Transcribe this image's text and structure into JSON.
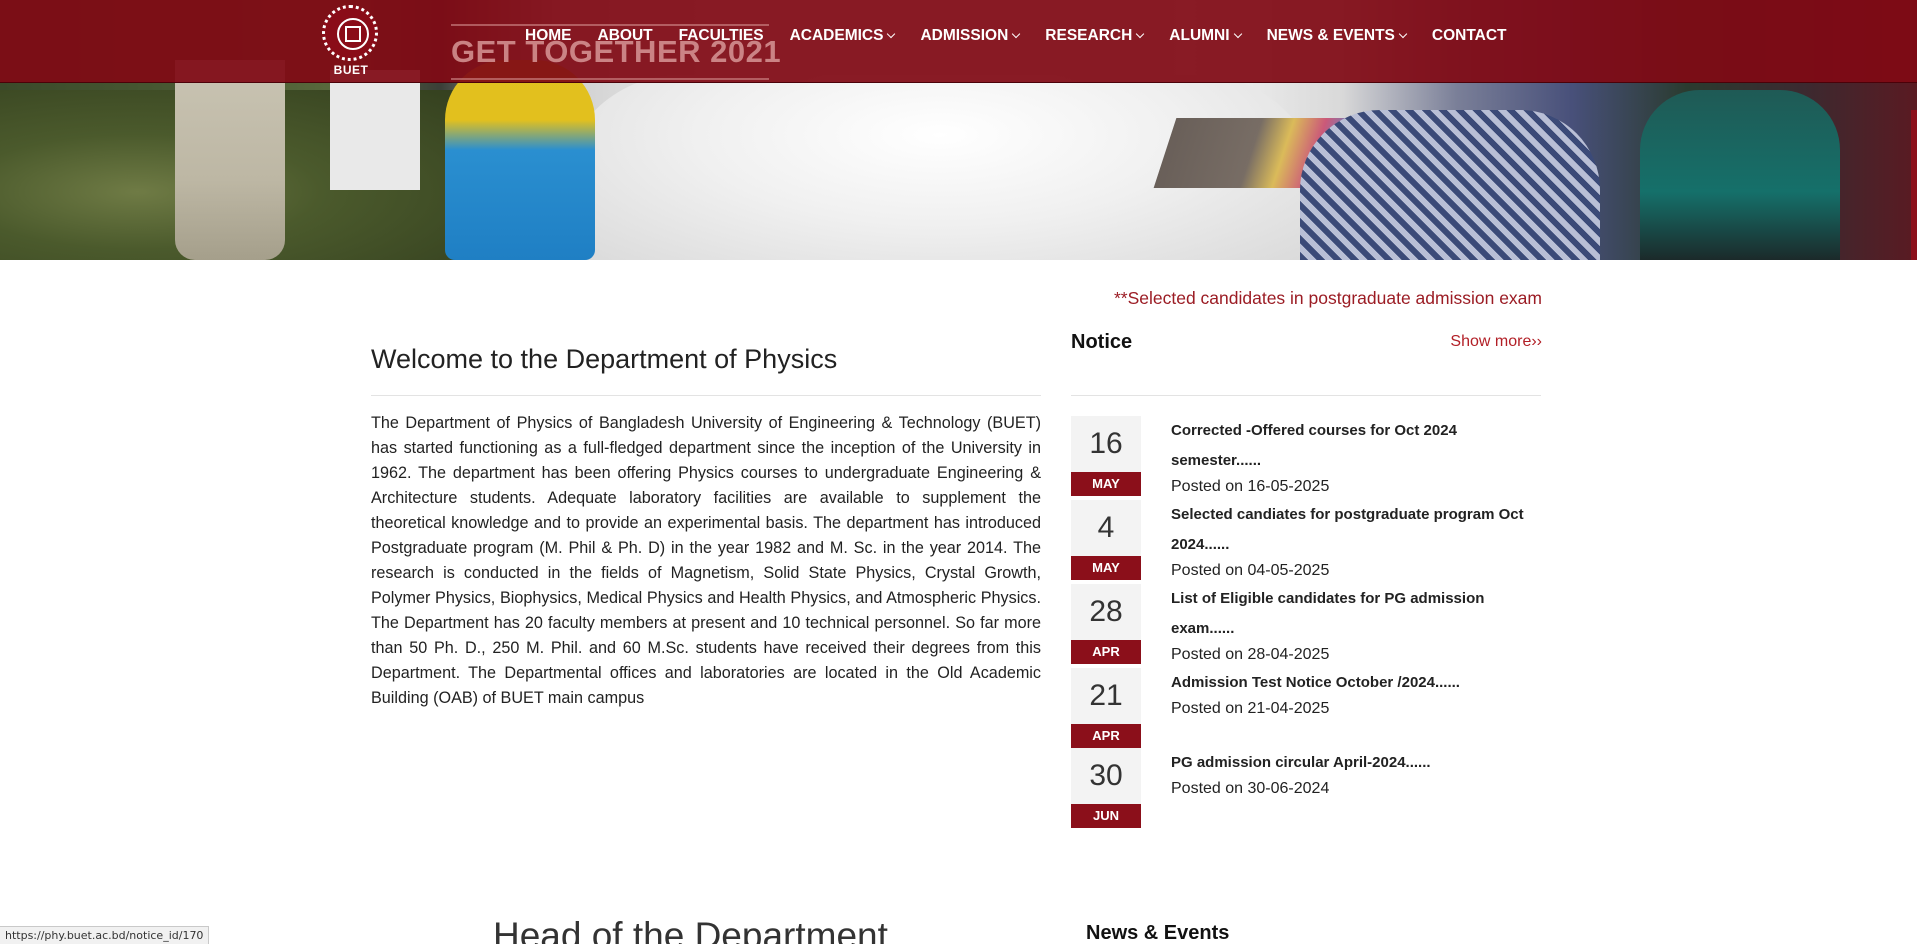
{
  "header": {
    "logo_text": "BUET",
    "banner_caption": "GET TOGETHER 2021",
    "nav": [
      {
        "label": "HOME",
        "dropdown": false
      },
      {
        "label": "ABOUT",
        "dropdown": false
      },
      {
        "label": "FACULTIES",
        "dropdown": false
      },
      {
        "label": "ACADEMICS",
        "dropdown": true
      },
      {
        "label": "ADMISSION",
        "dropdown": true
      },
      {
        "label": "RESEARCH",
        "dropdown": true
      },
      {
        "label": "ALUMNI",
        "dropdown": true
      },
      {
        "label": "NEWS & EVENTS",
        "dropdown": true
      },
      {
        "label": "CONTACT",
        "dropdown": false
      }
    ]
  },
  "marquee": "**Selected candidates in postgraduate admission exam",
  "welcome": {
    "title": "Welcome to the Department of Physics",
    "body": "The Department of Physics of Bangladesh University of Engineering & Technology (BUET) has started functioning as a full-fledged department since the inception of the University in 1962. The department has been offering Physics courses to undergraduate Engineering & Architecture students. Adequate laboratory facilities are available to supplement the theoretical knowledge and to provide an experimental basis. The department has introduced Postgraduate program (M. Phil & Ph. D) in the year 1982 and M. Sc. in the year 2014. The research is conducted in the fields of Magnetism, Solid State Physics, Crystal Growth, Polymer Physics, Biophysics, Medical Physics and Health Physics, and Atmospheric Physics. The Department has 20 faculty members at present and 10 technical personnel. So far more than 50 Ph. D., 250 M. Phil. and 60 M.Sc. students have received their degrees from this Department. The Departmental offices and laboratories are located in the Old Academic Building (OAB) of BUET main campus"
  },
  "notice": {
    "title": "Notice",
    "show_more": "Show more››",
    "items": [
      {
        "day": "16",
        "month": "MAY",
        "title": "Corrected -Offered courses for Oct 2024 semester......",
        "posted": "Posted on 16-05-2025"
      },
      {
        "day": "4",
        "month": "MAY",
        "title": "Selected candiates for postgraduate program Oct 2024......",
        "posted": "Posted on 04-05-2025"
      },
      {
        "day": "28",
        "month": "APR",
        "title": "List of Eligible candidates for PG admission exam......",
        "posted": "Posted on 28-04-2025"
      },
      {
        "day": "21",
        "month": "APR",
        "title": "Admission Test Notice October /2024......",
        "posted": "Posted on 21-04-2025"
      },
      {
        "day": "30",
        "month": "JUN",
        "title": "PG admission circular April-2024......",
        "posted": "Posted on 30-06-2024"
      }
    ]
  },
  "sections": {
    "head_title": "Head of the Department",
    "news_title": "News & Events"
  },
  "status_url": "https://phy.buet.ac.bd/notice_id/170",
  "colors": {
    "brand": "#8b0f1a",
    "accent_text": "#b21f26"
  }
}
